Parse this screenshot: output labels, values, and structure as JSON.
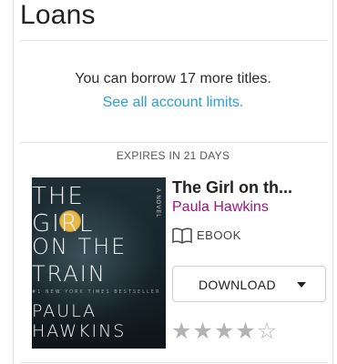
{
  "header": {
    "title": "Loans"
  },
  "account": {
    "borrow_text": "You can borrow 17 more titles.",
    "limits_link": "See all account limits."
  },
  "section": {
    "expires_label": "EXPIRES IN 21 DAYS"
  },
  "loan": {
    "title": "The Girl on th...",
    "author": "Paula Hawkins",
    "format": "EBOOK",
    "format_icon": "book-icon",
    "download_label": "DOWNLOAD",
    "download_icon": "caret-down-icon",
    "rating": 4,
    "rating_max": 5,
    "cover": {
      "line1": "THE",
      "line2": "GIRL",
      "line3": "ON THE",
      "line4": "TRAIN",
      "line5": "PAULA",
      "line6": "HAWKINS",
      "tagline": "#1 NEW YORK TIMES BESTSELLER",
      "novel": "A NOVEL"
    }
  },
  "colors": {
    "link": "#2aa0d6",
    "author": "#a0167e",
    "star": "#b3b3b3"
  }
}
